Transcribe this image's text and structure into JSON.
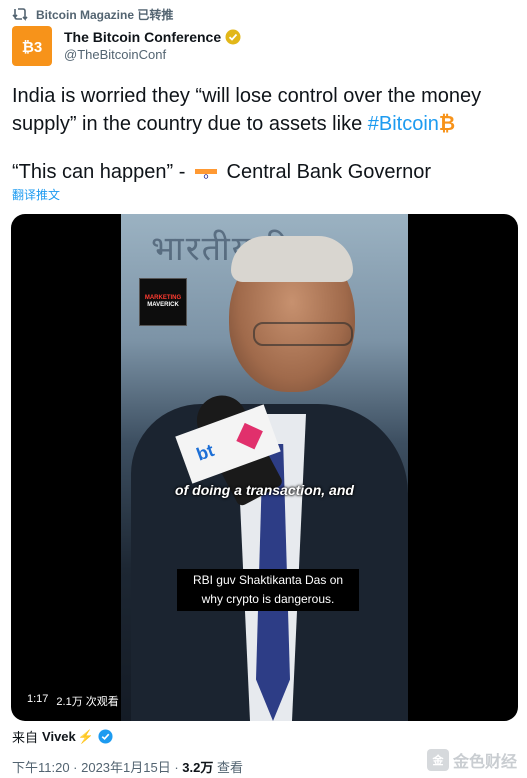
{
  "retweet": {
    "label": "Bitcoin Magazine 已转推",
    "icon": "retweet-icon"
  },
  "author": {
    "name": "The Bitcoin Conference",
    "handle": "@TheBitcoinConf",
    "avatar_text": "B3",
    "verified_color": "#f4b400"
  },
  "tweet": {
    "line1_prefix": "India is worried they “will lose control over the money supply” in the country due to assets like ",
    "hashtag": "#Bitcoin",
    "btc_emoji": "₿",
    "line2_quote": "“This can happen” - ",
    "line2_suffix": "Central Bank Governor",
    "translate": "翻译推文"
  },
  "video": {
    "banner_text": "भारतीय रि",
    "logo_line1": "MARKETING",
    "logo_line2": "MAVERICK",
    "mic_brand": "bt",
    "caption_top": "of doing a transaction, and",
    "caption_box": "RBI guv Shaktikanta Das on why crypto is dangerous.",
    "duration": "1:17",
    "views": "2.1万 次观看"
  },
  "from": {
    "prefix": "来自",
    "name": "Vivek",
    "bolt": "⚡"
  },
  "meta": {
    "time": "下午11:20 · 2023年1月15日 · ",
    "views_count": "3.2万",
    "views_label": " 查看"
  },
  "watermark": {
    "text": "金色财经"
  },
  "colors": {
    "accent": "#1d9bf0",
    "bitcoin": "#f7931a"
  }
}
